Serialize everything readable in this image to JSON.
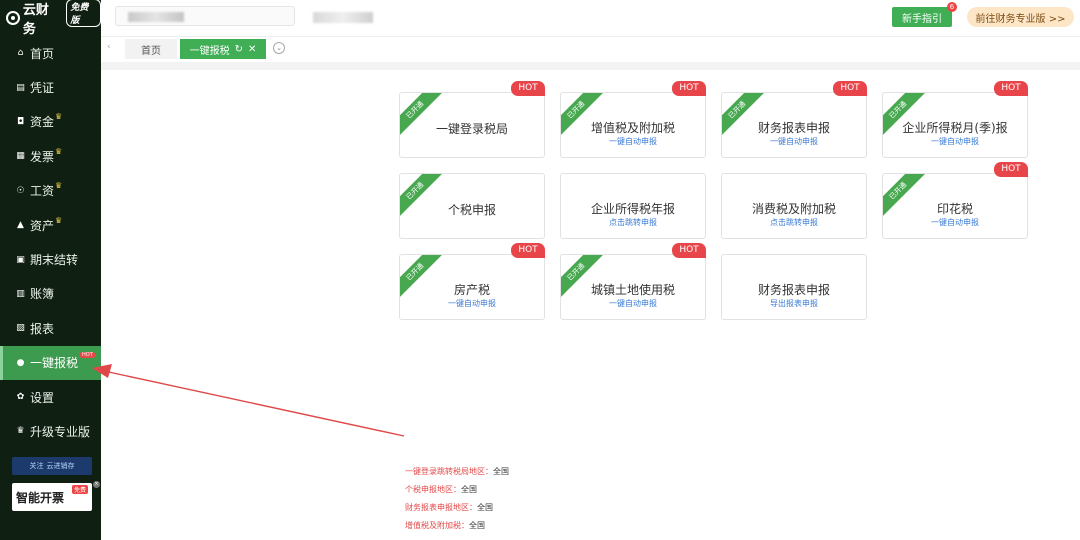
{
  "brand": {
    "name": "云财务",
    "badge": "免费版"
  },
  "sidebar": {
    "items": [
      {
        "label": "首页",
        "icon": "home-icon",
        "glyph": "⌂",
        "crown": false
      },
      {
        "label": "凭证",
        "icon": "voucher-icon",
        "glyph": "▤",
        "crown": false
      },
      {
        "label": "资金",
        "icon": "fund-icon",
        "glyph": "◘",
        "crown": true
      },
      {
        "label": "发票",
        "icon": "invoice-icon",
        "glyph": "▦",
        "crown": true
      },
      {
        "label": "工资",
        "icon": "salary-icon",
        "glyph": "☉",
        "crown": true
      },
      {
        "label": "资产",
        "icon": "asset-icon",
        "glyph": "▲",
        "crown": true
      },
      {
        "label": "期末结转",
        "icon": "carryover-icon",
        "glyph": "▣",
        "crown": false
      },
      {
        "label": "账簿",
        "icon": "ledger-icon",
        "glyph": "▥",
        "crown": false
      },
      {
        "label": "报表",
        "icon": "report-icon",
        "glyph": "▨",
        "crown": false
      },
      {
        "label": "一键报税",
        "icon": "tax-icon",
        "glyph": "●",
        "crown": false,
        "active": true,
        "hot": "HOT"
      },
      {
        "label": "设置",
        "icon": "settings-icon",
        "glyph": "✿",
        "crown": false
      },
      {
        "label": "升级专业版",
        "icon": "upgrade-icon",
        "glyph": "♛",
        "crown": false
      }
    ],
    "promo_follow": "关注",
    "promo_follow_brand": "云进销存",
    "promo_invoice": "智能开票",
    "promo_invoice_badge": "免费"
  },
  "topbar": {
    "search_value": "",
    "guide_label": "新手指引",
    "guide_badge": "6",
    "pro_label": "前往财务专业版 >>"
  },
  "tabs": {
    "home": "首页",
    "active": "一键报税",
    "refresh_icon": "↻",
    "close_icon": "✕"
  },
  "cards": [
    {
      "title": "一键登录税局",
      "sub": "",
      "ribbon": "已开通",
      "hot": "HOT"
    },
    {
      "title": "增值税及附加税",
      "sub": "一键自动申报",
      "ribbon": "已开通",
      "hot": "HOT"
    },
    {
      "title": "财务报表申报",
      "sub": "一键自动申报",
      "ribbon": "已开通",
      "hot": "HOT"
    },
    {
      "title": "企业所得税月(季)报",
      "sub": "一键自动申报",
      "ribbon": "已开通",
      "hot": "HOT"
    },
    {
      "title": "个税申报",
      "sub": "",
      "ribbon": "已开通",
      "hot": ""
    },
    {
      "title": "企业所得税年报",
      "sub": "点击跳转申报",
      "ribbon": "",
      "hot": ""
    },
    {
      "title": "消费税及附加税",
      "sub": "点击跳转申报",
      "ribbon": "",
      "hot": ""
    },
    {
      "title": "印花税",
      "sub": "一键自动申报",
      "ribbon": "已开通",
      "hot": "HOT"
    },
    {
      "title": "房产税",
      "sub": "一键自动申报",
      "ribbon": "已开通",
      "hot": "HOT"
    },
    {
      "title": "城镇土地使用税",
      "sub": "一键自动申报",
      "ribbon": "已开通",
      "hot": "HOT"
    },
    {
      "title": "财务报表申报",
      "sub": "导出报表申报",
      "ribbon": "",
      "hot": ""
    }
  ],
  "notes": [
    {
      "key": "一键登录跳转税局地区：",
      "value": "全国"
    },
    {
      "key": "个税申报地区：",
      "value": "全国"
    },
    {
      "key": "财务报表申报地区：",
      "value": "全国"
    },
    {
      "key": "增值税及附加税：",
      "value": "全国"
    }
  ],
  "colors": {
    "sidebar_bg": "#0f1f12",
    "accent_green": "#3fae55",
    "hot_red": "#e8454a",
    "link_blue": "#3a7bd5",
    "arrow_red": "#e04848"
  }
}
